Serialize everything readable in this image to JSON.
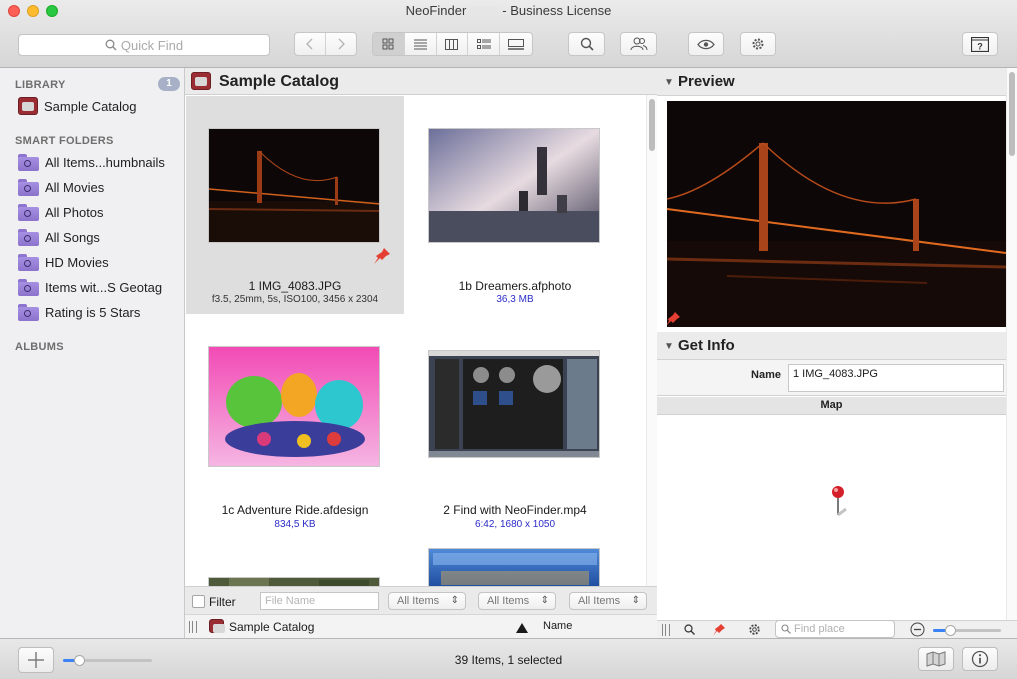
{
  "window": {
    "title_left": "NeoFinder",
    "title_right": "- Business License"
  },
  "toolbar": {
    "search_placeholder": "Quick Find",
    "icons": [
      "search-icon",
      "back-chevron-icon",
      "forward-chevron-icon",
      "icon-view-icon",
      "list-view-icon",
      "column-view-icon",
      "detail-list-icon",
      "filmstrip-view-icon",
      "find-icon",
      "people-icon",
      "eye-icon",
      "gear-icon",
      "help-icon"
    ]
  },
  "sidebar": {
    "library_header": "LIBRARY",
    "library_badge": "1",
    "library_items": [
      {
        "label": "Sample Catalog"
      }
    ],
    "smart_header": "SMART FOLDERS",
    "smart_items": [
      {
        "label": "All Items...humbnails"
      },
      {
        "label": "All Movies"
      },
      {
        "label": "All Photos"
      },
      {
        "label": "All Songs"
      },
      {
        "label": "HD Movies"
      },
      {
        "label": "Items wit...S Geotag"
      },
      {
        "label": "Rating is 5 Stars"
      }
    ],
    "albums_header": "ALBUMS"
  },
  "content": {
    "title": "Sample Catalog",
    "items": [
      {
        "name": "1 IMG_4083.JPG",
        "info": "f3.5, 25mm, 5s, ISO100, 3456 x 2304",
        "selected": true
      },
      {
        "name": "1b Dreamers.afphoto",
        "info": "36,3 MB"
      },
      {
        "name": "1c Adventure Ride.afdesign",
        "info": "834,5 KB"
      },
      {
        "name": "2 Find with NeoFinder.mp4",
        "info": "6:42, 1680 x 1050"
      },
      {
        "name": "",
        "info": ""
      },
      {
        "name": "",
        "info": ""
      }
    ],
    "filter_label": "Filter",
    "file_name_placeholder": "File Name",
    "popups": [
      "All Items",
      "All Items",
      "All Items"
    ],
    "path_label": "Sample Catalog",
    "sort_column": "Name"
  },
  "right": {
    "preview_header": "Preview",
    "info_header": "Get Info",
    "name_label": "Name",
    "name_value": "1 IMG_4083.JPG",
    "map_header": "Map",
    "find_place_placeholder": "Find place"
  },
  "bottom": {
    "status": "39 Items, 1 selected",
    "thumbnail_size": 0.18,
    "map_zoom": 0.25
  }
}
